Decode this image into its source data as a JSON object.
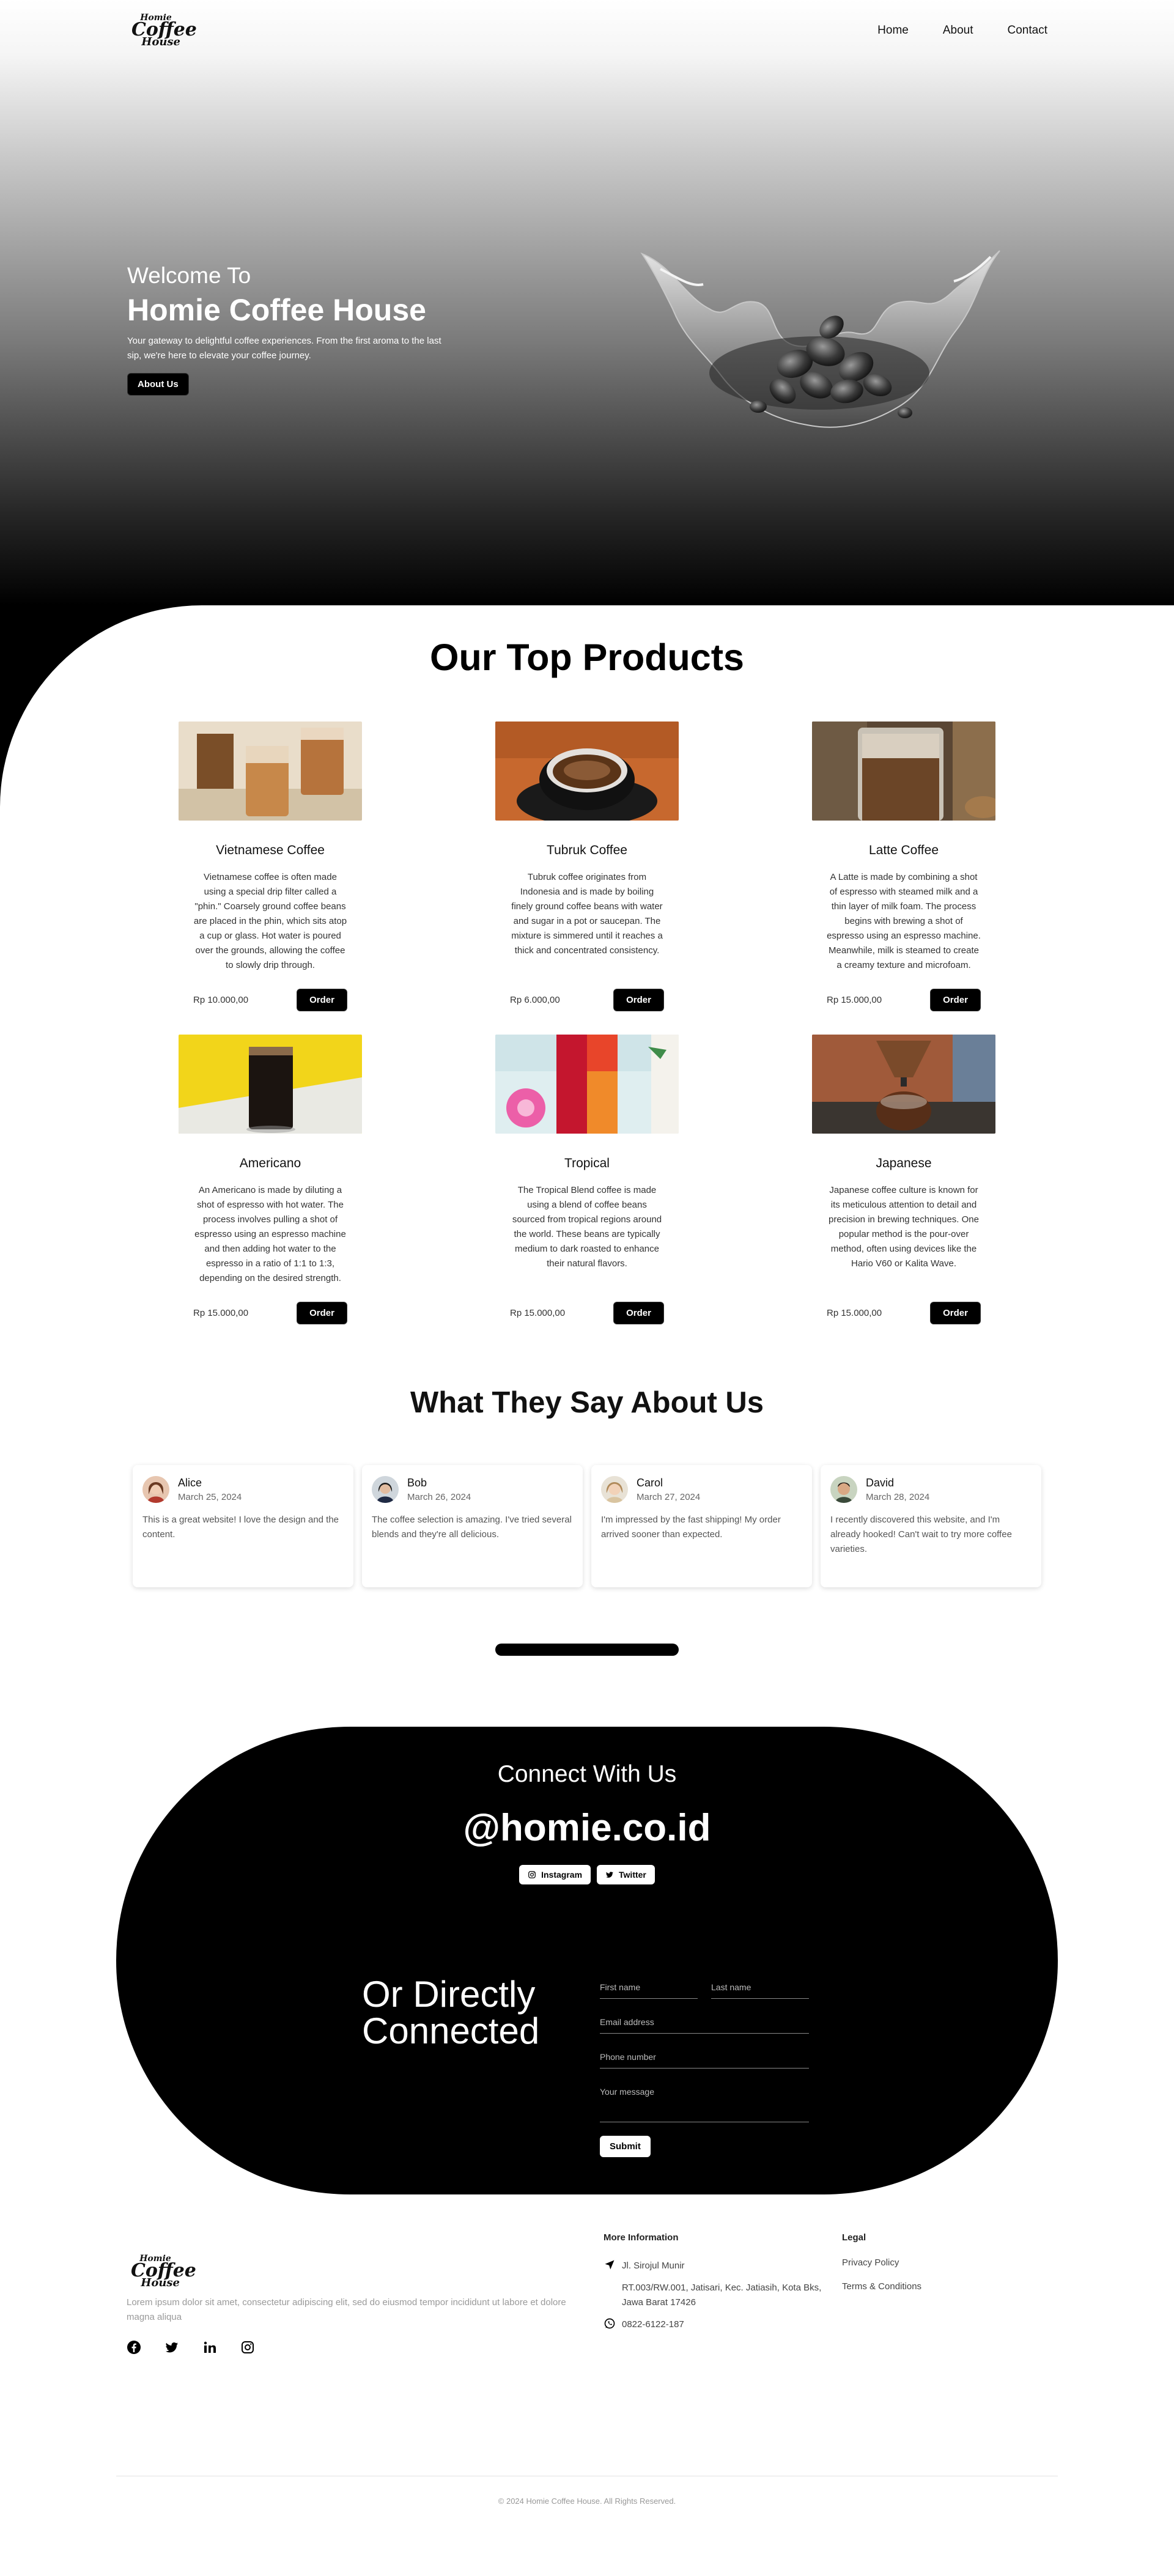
{
  "nav": {
    "logo": {
      "line1": "Homie",
      "line2": "Coffee",
      "line3": "House"
    },
    "links": [
      "Home",
      "About",
      "Contact"
    ]
  },
  "hero": {
    "welcome": "Welcome To",
    "title": "Homie Coffee House",
    "description": "Your gateway to delightful coffee experiences. From the first aroma to the last sip, we're here to elevate your coffee journey.",
    "button": "About Us"
  },
  "products": {
    "title": "Our Top Products",
    "order_label": "Order",
    "items": [
      {
        "name": "Vietnamese Coffee",
        "description": "Vietnamese coffee is often made using a special drip filter called a \"phin.\" Coarsely ground coffee beans are placed in the phin, which sits atop a cup or glass. Hot water is poured over the grounds, allowing the coffee to slowly drip through.",
        "price": "Rp 10.000,00"
      },
      {
        "name": "Tubruk Coffee",
        "description": "Tubruk coffee originates from Indonesia and is made by boiling finely ground coffee beans with water and sugar in a pot or saucepan. The mixture is simmered until it reaches a thick and concentrated consistency.",
        "price": "Rp 6.000,00"
      },
      {
        "name": "Latte Coffee",
        "description": "A Latte is made by combining a shot of espresso with steamed milk and a thin layer of milk foam. The process begins with brewing a shot of espresso using an espresso machine. Meanwhile, milk is steamed to create a creamy texture and microfoam.",
        "price": "Rp 15.000,00"
      },
      {
        "name": "Americano",
        "description": "An Americano is made by diluting a shot of espresso with hot water. The process involves pulling a shot of espresso using an espresso machine and then adding hot water to the espresso in a ratio of 1:1 to 1:3, depending on the desired strength.",
        "price": "Rp 15.000,00"
      },
      {
        "name": "Tropical",
        "description": "The Tropical Blend coffee is made using a blend of coffee beans sourced from tropical regions around the world. These beans are typically medium to dark roasted to enhance their natural flavors.",
        "price": "Rp 15.000,00"
      },
      {
        "name": "Japanese",
        "description": "Japanese coffee culture is known for its meticulous attention to detail and precision in brewing techniques. One popular method is the pour-over method, often using devices like the Hario V60 or Kalita Wave.",
        "price": "Rp 15.000,00"
      }
    ]
  },
  "testimonials": {
    "title": "What They Say About Us",
    "items": [
      {
        "name": "Alice",
        "date": "March 25, 2024",
        "text": "This is a great website! I love the design and the content."
      },
      {
        "name": "Bob",
        "date": "March 26, 2024",
        "text": "The coffee selection is amazing. I've tried several blends and they're all delicious."
      },
      {
        "name": "Carol",
        "date": "March 27, 2024",
        "text": "I'm impressed by the fast shipping! My order arrived sooner than expected."
      },
      {
        "name": "David",
        "date": "March 28, 2024",
        "text": "I recently discovered this website, and I'm already hooked! Can't wait to try more coffee varieties."
      }
    ]
  },
  "connect": {
    "title": "Connect With Us",
    "handle": "@homie.co.id",
    "instagram": "Instagram",
    "twitter": "Twitter",
    "direct_line1": "Or Directly",
    "direct_line2": "Connected",
    "form": {
      "first_name": "First name",
      "last_name": "Last name",
      "email": "Email address",
      "phone": "Phone number",
      "message": "Your message",
      "submit": "Submit"
    }
  },
  "footer": {
    "lorem": "Lorem ipsum dolor sit amet, consectetur adipiscing elit, sed do eiusmod tempor incididunt ut labore et dolore magna aliqua",
    "more_info_title": "More Information",
    "address1": "Jl. Sirojul Munir",
    "address2": "RT.003/RW.001, Jatisari, Kec. Jatiasih, Kota Bks, Jawa Barat 17426",
    "phone": "0822-6122-187",
    "legal_title": "Legal",
    "privacy": "Privacy Policy",
    "terms": "Terms & Conditions",
    "copyright": "© 2024 Homie Coffee House. All Rights Reserved."
  }
}
